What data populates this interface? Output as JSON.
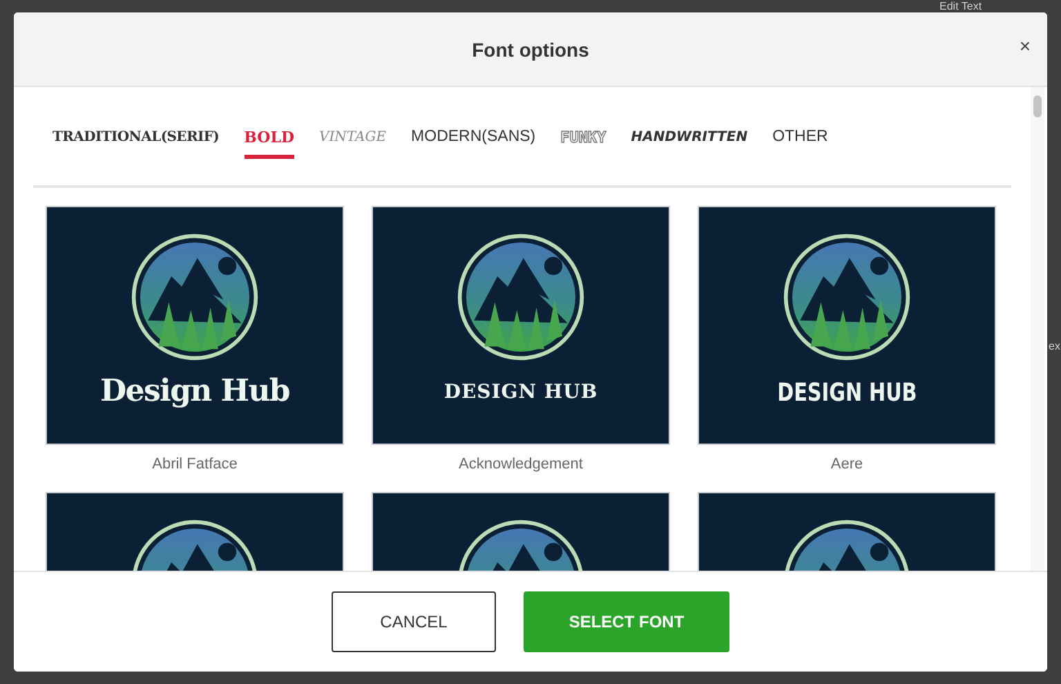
{
  "background": {
    "heading": "Edit Text",
    "fragment": "ex"
  },
  "dialog": {
    "title": "Font options",
    "close": "×"
  },
  "tabs": [
    {
      "label": "TRADITIONAL(SERIF)",
      "kind": "serif",
      "selected": false
    },
    {
      "label": "BOLD",
      "kind": "bold",
      "selected": true
    },
    {
      "label": "VINTAGE",
      "kind": "vintage",
      "selected": false
    },
    {
      "label": "MODERN(SANS)",
      "kind": "sans",
      "selected": false
    },
    {
      "label": "FUNKY",
      "kind": "funky",
      "selected": false
    },
    {
      "label": "HANDWRITTEN",
      "kind": "handwritten",
      "selected": false
    },
    {
      "label": "OTHER",
      "kind": "plain",
      "selected": false
    }
  ],
  "fonts": [
    {
      "kind": "full",
      "logo_text": "Design Hub",
      "caption": "Abril Fatface"
    },
    {
      "kind": "full",
      "logo_text": "DESIGN HUB",
      "caption": "Acknowledgement"
    },
    {
      "kind": "full",
      "logo_text": "DESIGN HUB",
      "caption": "Aere"
    },
    {
      "kind": "partial"
    },
    {
      "kind": "partial"
    },
    {
      "kind": "partial"
    }
  ],
  "buttons": [
    {
      "label": "CANCEL",
      "kind": "secondary"
    },
    {
      "label": "SELECT FONT",
      "kind": "primary"
    }
  ]
}
